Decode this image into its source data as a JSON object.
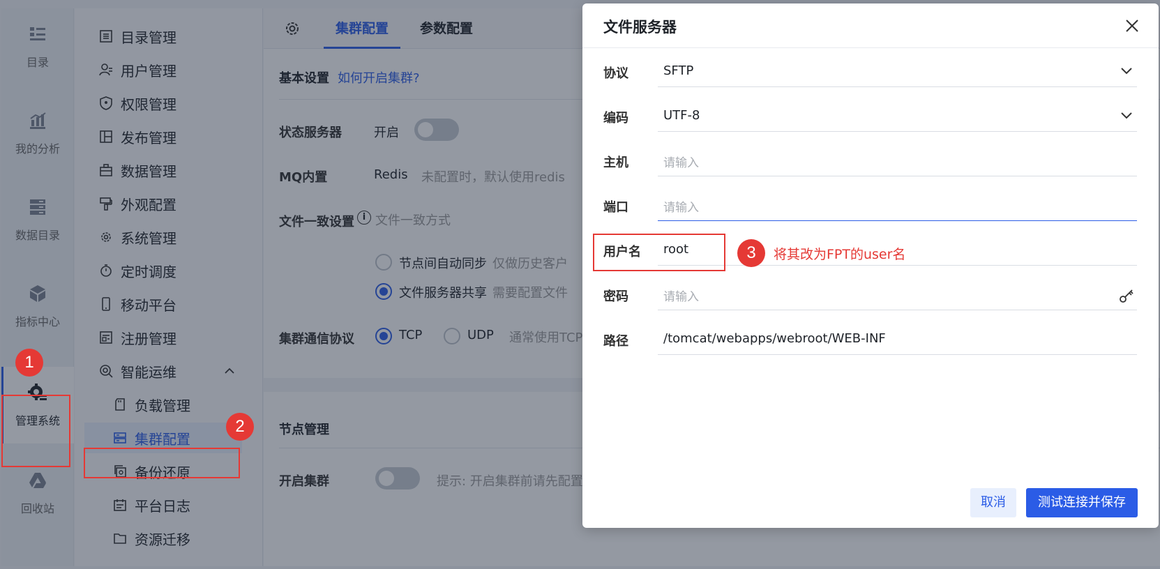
{
  "rail": {
    "items": [
      {
        "label": "目录",
        "icon": "catalog-list-icon"
      },
      {
        "label": "我的分析",
        "icon": "analysis-chart-icon"
      },
      {
        "label": "数据目录",
        "icon": "data-catalog-icon"
      },
      {
        "label": "指标中心",
        "icon": "cube-icon"
      },
      {
        "label": "管理系统",
        "icon": "gear-admin-icon",
        "active": true
      },
      {
        "label": "回收站",
        "icon": "recycle-drive-icon"
      }
    ]
  },
  "menu": {
    "items": [
      {
        "label": "目录管理"
      },
      {
        "label": "用户管理"
      },
      {
        "label": "权限管理"
      },
      {
        "label": "发布管理"
      },
      {
        "label": "数据管理"
      },
      {
        "label": "外观配置"
      },
      {
        "label": "系统管理"
      },
      {
        "label": "定时调度"
      },
      {
        "label": "移动平台"
      },
      {
        "label": "注册管理"
      },
      {
        "label": "智能运维"
      },
      {
        "label": "负载管理"
      },
      {
        "label": "集群配置"
      },
      {
        "label": "备份还原"
      },
      {
        "label": "平台日志"
      },
      {
        "label": "资源迁移"
      }
    ]
  },
  "tabs": {
    "cluster": "集群配置",
    "params": "参数配置"
  },
  "basic": {
    "title": "基本设置",
    "help_link": "如何开启集群?",
    "state_server_label": "状态服务器",
    "state_server_value": "开启",
    "mq_label": "MQ内置",
    "mq_value": "Redis",
    "mq_hint": "未配置时，默认使用redis",
    "file_consistency_label": "文件一致设置",
    "file_consistency_placeholder": "文件一致方式",
    "opt_sync": "节点间自动同步",
    "opt_sync_hint": "仅做历史客户",
    "opt_share": "文件服务器共享",
    "opt_share_hint": "需要配置文件",
    "protocol_label": "集群通信协议",
    "protocol_tcp": "TCP",
    "protocol_udp": "UDP",
    "protocol_hint": "通常使用TCP"
  },
  "nodes": {
    "title": "节点管理",
    "enable_label": "开启集群",
    "enable_hint": "提示: 开启集群前请先配置"
  },
  "dialog": {
    "title": "文件服务器",
    "fields": {
      "protocol": {
        "label": "协议",
        "value": "SFTP"
      },
      "encoding": {
        "label": "编码",
        "value": "UTF-8"
      },
      "host": {
        "label": "主机",
        "placeholder": "请输入"
      },
      "port": {
        "label": "端口",
        "placeholder": "请输入"
      },
      "username": {
        "label": "用户名",
        "value": "root"
      },
      "password": {
        "label": "密码",
        "placeholder": "请输入"
      },
      "path": {
        "label": "路径",
        "value": "/tomcat/webapps/webroot/WEB-INF"
      }
    },
    "cancel": "取消",
    "save": "测试连接并保存"
  },
  "annotations": {
    "step1": "1",
    "step2": "2",
    "step3": "3",
    "step3_text": "将其改为FPT的user名"
  },
  "colors": {
    "accent": "#2b5ce6",
    "annotation": "#e53935"
  }
}
